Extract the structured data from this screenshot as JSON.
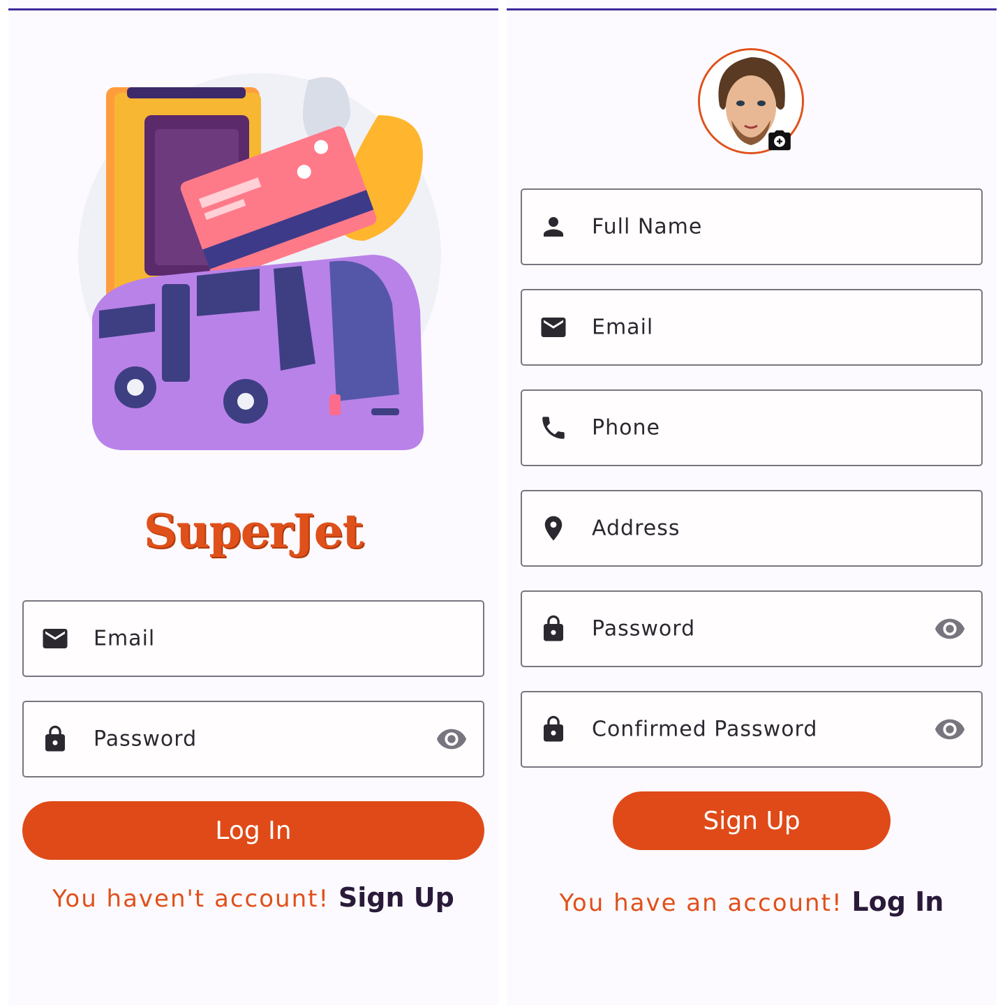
{
  "login": {
    "brand": "SuperJet",
    "email_label": "Email",
    "password_label": "Password",
    "login_button": "Log In",
    "footer_prompt": "You haven't account!",
    "footer_link": "Sign Up"
  },
  "signup": {
    "full_name_label": "Full Name",
    "email_label": "Email",
    "phone_label": "Phone",
    "address_label": "Address",
    "password_label": "Password",
    "confirm_password_label": "Confirmed Password",
    "signup_button": "Sign Up",
    "footer_prompt": "You have an account!",
    "footer_link": "Log In"
  },
  "colors": {
    "accent": "#df4a18",
    "header_line": "#3d2a9a",
    "link": "#2a1a3a",
    "background": "#fcfaff"
  },
  "icons": [
    "email-icon",
    "lock-icon",
    "eye-icon",
    "person-icon",
    "phone-icon",
    "location-icon",
    "camera-icon"
  ]
}
